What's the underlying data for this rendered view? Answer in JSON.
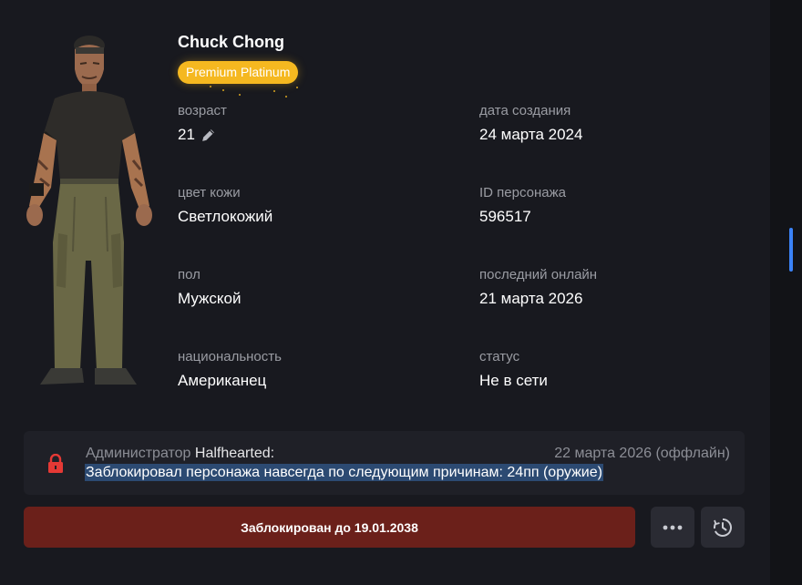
{
  "character": {
    "name": "Chuck Chong",
    "badge": "Premium Platinum"
  },
  "fields": {
    "age": {
      "label": "возраст",
      "value": "21"
    },
    "created": {
      "label": "дата создания",
      "value": "24 марта 2024"
    },
    "skin": {
      "label": "цвет кожи",
      "value": "Светлокожий"
    },
    "id": {
      "label": "ID персонажа",
      "value": "596517"
    },
    "sex": {
      "label": "пол",
      "value": "Мужской"
    },
    "last_online": {
      "label": "последний онлайн",
      "value": "21 марта 2026"
    },
    "nationality": {
      "label": "национальность",
      "value": "Американец"
    },
    "status": {
      "label": "статус",
      "value": "Не в сети"
    }
  },
  "ban": {
    "admin_prefix": "Администратор",
    "admin_name": "Halfhearted:",
    "date": "22 марта 2026 (оффлайн)",
    "reason": "Заблокировал персонажа навсегда по следующим причинам: 24пп (оружие)",
    "button_label": "Заблокирован до 19.01.2038"
  },
  "icons": {
    "lock": "lock-icon",
    "edit": "pencil-icon",
    "more": "more-horizontal-icon",
    "history": "history-clock-icon"
  },
  "colors": {
    "badge": "#f5b820",
    "ban_button": "#6b201a",
    "lock": "#e53935",
    "scrollbar": "#3b82f6"
  }
}
